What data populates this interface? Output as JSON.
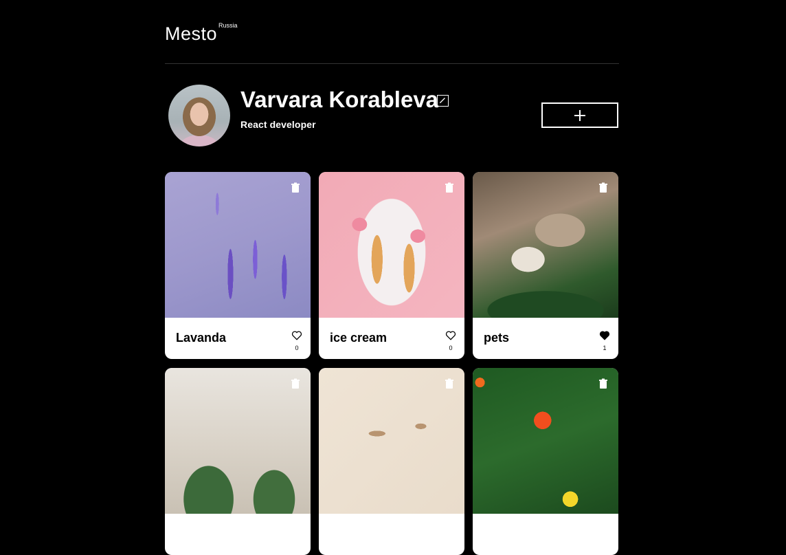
{
  "header": {
    "logo": "Mesto",
    "logo_sub": "Russia"
  },
  "profile": {
    "name": "Varvara Korableva",
    "about": "React developer"
  },
  "cards": [
    {
      "title": "Lavanda",
      "likes": "0",
      "liked": false,
      "image": "lavender"
    },
    {
      "title": "ice cream",
      "likes": "0",
      "liked": false,
      "image": "ice-cream"
    },
    {
      "title": "pets",
      "likes": "1",
      "liked": true,
      "image": "pets"
    },
    {
      "title": "",
      "likes": "",
      "liked": false,
      "image": "plants"
    },
    {
      "title": "",
      "likes": "",
      "liked": false,
      "image": "dried-flowers"
    },
    {
      "title": "",
      "likes": "",
      "liked": false,
      "image": "ranunculus"
    }
  ],
  "icons": {
    "edit": "pencil-icon",
    "add": "plus-icon",
    "delete": "trash-icon",
    "like": "heart-icon"
  },
  "colors": {
    "background": "#000000",
    "card": "#ffffff",
    "text": "#000000"
  }
}
